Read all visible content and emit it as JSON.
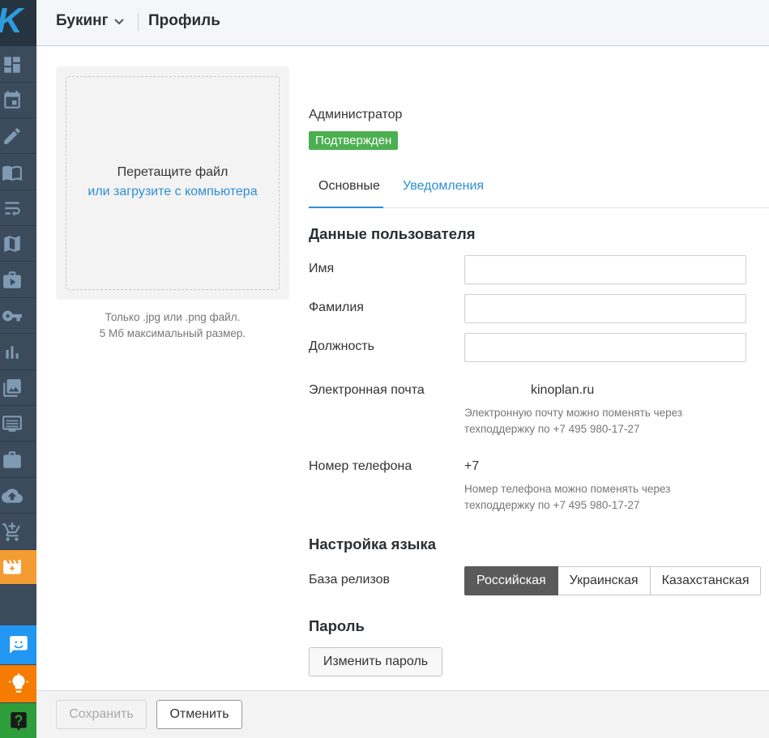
{
  "sidebar": {
    "logo": "K",
    "items": [
      {
        "icon": "dashboard-icon"
      },
      {
        "icon": "calendar-icon"
      },
      {
        "icon": "pencil-icon"
      },
      {
        "icon": "book-icon"
      },
      {
        "icon": "wrap-text-icon"
      },
      {
        "icon": "map-icon"
      },
      {
        "icon": "video-folder-icon"
      },
      {
        "icon": "key-icon"
      },
      {
        "icon": "bar-chart-icon"
      },
      {
        "icon": "images-icon"
      },
      {
        "icon": "list-screen-icon"
      },
      {
        "icon": "briefcase-icon"
      },
      {
        "icon": "cloud-upload-icon"
      },
      {
        "icon": "cart-icon"
      },
      {
        "icon": "clapperboard-icon",
        "active": true
      }
    ],
    "bottom": [
      {
        "icon": "chat-icon",
        "color": "#2196f3"
      },
      {
        "icon": "lightbulb-icon",
        "color": "#f57c00"
      },
      {
        "icon": "help-icon",
        "color": "#2e9e3b"
      }
    ]
  },
  "header": {
    "section": "Букинг",
    "title": "Профиль"
  },
  "upload": {
    "drop_text": "Перетащите файл",
    "browse_link": "или загрузите с компьютера",
    "hint_line1": "Только .jpg или .png файл.",
    "hint_line2": "5 Мб максимальный размер."
  },
  "profile": {
    "role": "Администратор",
    "status_badge": "Подтвержден"
  },
  "tabs": [
    {
      "label": "Основные",
      "active": true
    },
    {
      "label": "Уведомления",
      "active": false
    }
  ],
  "user_data": {
    "heading": "Данные пользователя",
    "first_name_label": "Имя",
    "first_name_value": "",
    "last_name_label": "Фамилия",
    "last_name_value": "",
    "position_label": "Должность",
    "position_value": "",
    "email_label": "Электронная почта",
    "email_value": "kinoplan.ru",
    "email_note_line1": "Электронную почту можно поменять через",
    "email_note_line2": "техподдержку по +7 495 980-17-27",
    "phone_label": "Номер телефона",
    "phone_value": "+7",
    "phone_note_line1": "Номер телефона можно поменять через",
    "phone_note_line2": "техподдержку по +7 495 980-17-27"
  },
  "language": {
    "heading": "Настройка языка",
    "release_base_label": "База релизов",
    "options": [
      "Российская",
      "Украинская",
      "Казахстанская"
    ],
    "selected": "Российская"
  },
  "password": {
    "heading": "Пароль",
    "change_button": "Изменить пароль"
  },
  "footer": {
    "save_button": "Сохранить",
    "cancel_button": "Отменить"
  },
  "colors": {
    "accent": "#2d8fd5",
    "success": "#4caf50",
    "sidebar_bg": "#3b4b5c",
    "active_nav": "#f39c32"
  }
}
